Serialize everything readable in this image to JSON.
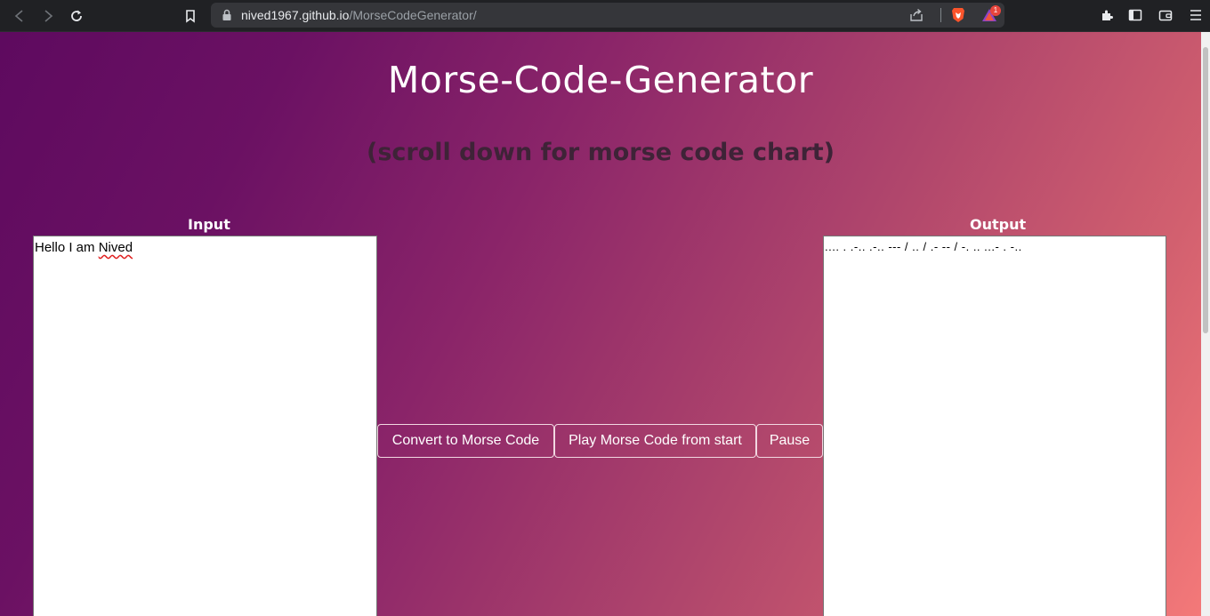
{
  "browser": {
    "url_host": "nived1967.github.io",
    "url_path": "/MorseCodeGenerator/",
    "rewards_badge": "1"
  },
  "page": {
    "title": "Morse-Code-Generator",
    "subtitle": "(scroll down for morse code chart)",
    "input_label": "Input",
    "output_label": "Output",
    "input_value": "Hello I am ",
    "input_value_misspelled": "Nived",
    "output_value": ".... . .-.. .-.. --- / .. / .- -- / -. .. ...- . -..",
    "buttons": {
      "convert": "Convert to Morse Code",
      "play": "Play Morse Code from start",
      "pause": "Pause"
    }
  },
  "colors": {
    "gradient_start": "#5e0a5f",
    "gradient_end": "#f47979",
    "subtitle": "#3e2337"
  }
}
